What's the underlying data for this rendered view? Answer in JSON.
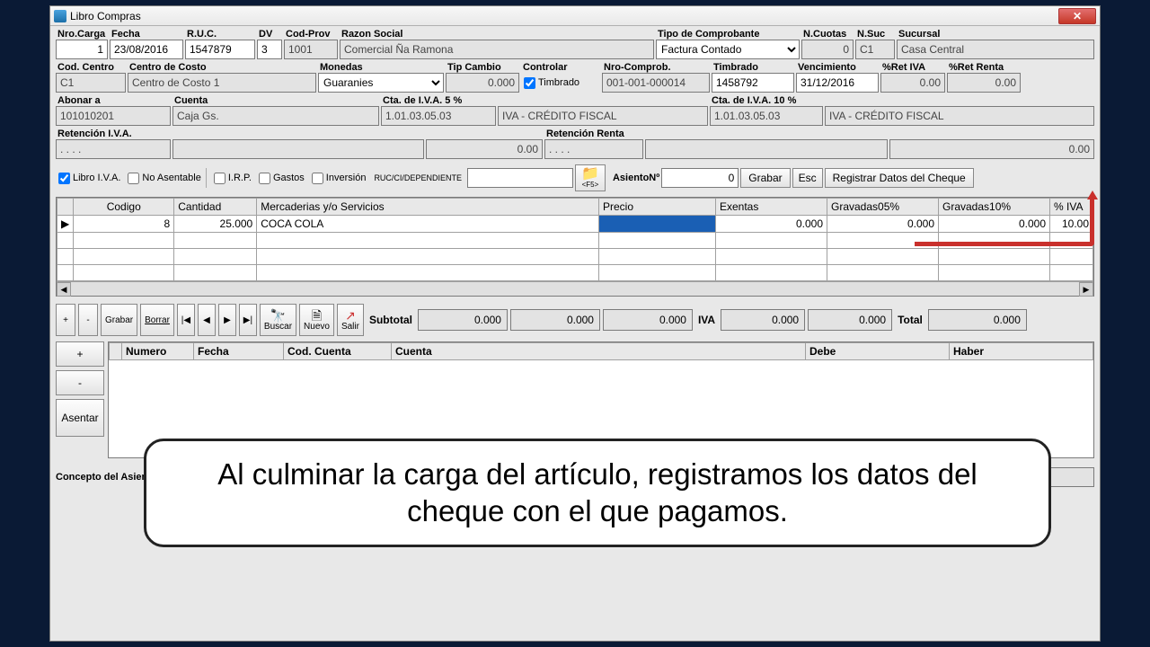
{
  "window": {
    "title": "Libro Compras",
    "close": "✕"
  },
  "r1": {
    "nro_carga_lbl": "Nro.Carga",
    "nro_carga": "1",
    "fecha_lbl": "Fecha",
    "fecha": "23/08/2016",
    "ruc_lbl": "R.U.C.",
    "ruc": "1547879",
    "dv_lbl": "DV",
    "dv": "3",
    "codprov_lbl": "Cod-Prov",
    "codprov": "1001",
    "razon_lbl": "Razon Social",
    "razon": "Comercial Ña Ramona",
    "tipo_lbl": "Tipo de Comprobante",
    "tipo": "Factura Contado",
    "ncuotas_lbl": "N.Cuotas",
    "ncuotas": "0",
    "nsuc_lbl": "N.Suc",
    "nsuc": "C1",
    "sucursal_lbl": "Sucursal",
    "sucursal": "Casa Central"
  },
  "r2": {
    "codcentro_lbl": "Cod. Centro",
    "codcentro": "C1",
    "centro_lbl": "Centro de Costo",
    "centro": "Centro de Costo 1",
    "monedas_lbl": "Monedas",
    "monedas": "Guaranies",
    "tipcambio_lbl": "Tip Cambio",
    "tipcambio": "0.000",
    "controlar_lbl": "Controlar",
    "timbrado_chk": "Timbrado",
    "nrocomp_lbl": "Nro-Comprob.",
    "nrocomp": "001-001-000014",
    "timbrado_lbl": "Timbrado",
    "timbrado": "1458792",
    "venc_lbl": "Vencimiento",
    "venc": "31/12/2016",
    "retiva_lbl": "%Ret IVA",
    "retiva": "0.00",
    "retrenta_lbl": "%Ret Renta",
    "retrenta": "0.00"
  },
  "r3": {
    "abonar_lbl": "Abonar a",
    "abonar": "101010201",
    "cuenta_lbl": "Cuenta",
    "cuenta": "Caja Gs.",
    "cta5_lbl": "Cta. de I.V.A. 5 %",
    "cta5_cod": "1.01.03.05.03",
    "cta5_desc": "IVA - CRÉDITO FISCAL",
    "cta10_lbl": "Cta. de I.V.A. 10 %",
    "cta10_cod": "1.01.03.05.03",
    "cta10_desc": "IVA - CRÉDITO FISCAL"
  },
  "r4": {
    "retiva_lbl": "Retención I.V.A.",
    "retiva_cod": ". . . .",
    "retiva_desc": "",
    "retiva_val": "0.00",
    "retrenta_lbl": "Retención Renta",
    "retrenta_cod": ". . . .",
    "retrenta_desc": "",
    "retrenta_val": "0.00"
  },
  "opts": {
    "libro": "Libro I.V.A.",
    "noasentable": "No Asentable",
    "irp": "I.R.P.",
    "gastos": "Gastos",
    "inversion": "Inversión",
    "rucdep": "RUC/CI/DEPENDIENTE",
    "f5": "<F5>",
    "asiento_lbl": "AsientoNº",
    "asiento": "0",
    "grabar": "Grabar",
    "esc": "Esc",
    "regcheque": "Registrar Datos del Cheque"
  },
  "grid": {
    "cols": [
      "",
      "Codigo",
      "Cantidad",
      "Mercaderias y/o Servicios",
      "Precio",
      "Exentas",
      "Gravadas05%",
      "Gravadas10%",
      "% IVA"
    ],
    "rows": [
      {
        "marker": "▶",
        "codigo": "8",
        "cantidad": "25.000",
        "desc": "COCA COLA",
        "precio": "",
        "exentas": "0.000",
        "grav05": "0.000",
        "grav10": "0.000",
        "iva": "10.00"
      }
    ]
  },
  "tb": {
    "plus": "+",
    "minus": "-",
    "grabar": "Grabar",
    "borrar": "Borrar",
    "buscar": "Buscar",
    "nuevo": "Nuevo",
    "salir": "Salir",
    "subtotal_lbl": "Subtotal",
    "sub1": "0.000",
    "sub2": "0.000",
    "sub3": "0.000",
    "iva_lbl": "IVA",
    "iva1": "0.000",
    "iva2": "0.000",
    "total_lbl": "Total",
    "total": "0.000"
  },
  "grid2": {
    "cols": [
      "Numero",
      "Fecha",
      "Cod. Cuenta",
      "Cuenta",
      "Debe",
      "Haber"
    ],
    "side": {
      "plus": "+",
      "minus": "-",
      "asentar": "Asentar"
    }
  },
  "concept": {
    "lbl": "Concepto del Asiento",
    "val": ""
  },
  "bubble": "Al culminar la carga del artículo, registramos los datos del cheque con el que pagamos."
}
